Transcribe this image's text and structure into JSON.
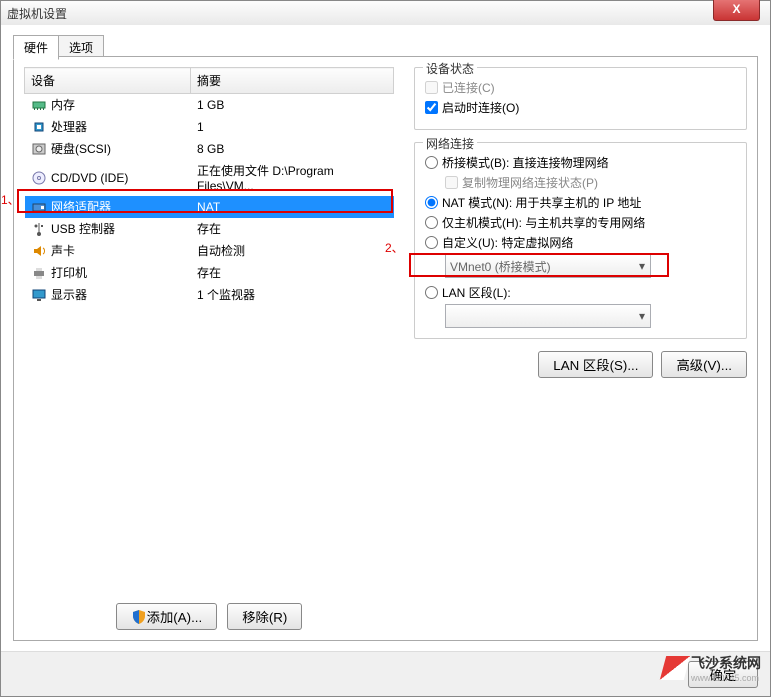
{
  "window_title": "虚拟机设置",
  "tabs": {
    "hardware": "硬件",
    "options": "选项"
  },
  "col_headers": {
    "device": "设备",
    "summary": "摘要"
  },
  "devices": [
    {
      "name": "内存",
      "summary": "1 GB",
      "icon": "memory"
    },
    {
      "name": "处理器",
      "summary": "1",
      "icon": "cpu"
    },
    {
      "name": "硬盘(SCSI)",
      "summary": "8 GB",
      "icon": "hdd"
    },
    {
      "name": "CD/DVD (IDE)",
      "summary": "正在使用文件 D:\\Program Files\\VM...",
      "icon": "cd"
    },
    {
      "name": "网络适配器",
      "summary": "NAT",
      "icon": "nic",
      "selected": true
    },
    {
      "name": "USB 控制器",
      "summary": "存在",
      "icon": "usb"
    },
    {
      "name": "声卡",
      "summary": "自动检测",
      "icon": "sound"
    },
    {
      "name": "打印机",
      "summary": "存在",
      "icon": "printer"
    },
    {
      "name": "显示器",
      "summary": "1 个监视器",
      "icon": "display"
    }
  ],
  "annotations": {
    "one": "1、",
    "two": "2、"
  },
  "left_buttons": {
    "add": "添加(A)...",
    "remove": "移除(R)"
  },
  "status_group": {
    "title": "设备状态",
    "connected": "已连接(C)",
    "connect_on": "启动时连接(O)"
  },
  "conn_group": {
    "title": "网络连接",
    "bridge": "桥接模式(B): 直接连接物理网络",
    "replicate": "复制物理网络连接状态(P)",
    "nat": "NAT 模式(N): 用于共享主机的 IP 地址",
    "hostonly": "仅主机模式(H): 与主机共享的专用网络",
    "custom": "自定义(U): 特定虚拟网络",
    "custom_select": "VMnet0 (桥接模式)",
    "lan": "LAN 区段(L):"
  },
  "right_buttons": {
    "lanseg": "LAN 区段(S)...",
    "advanced": "高级(V)..."
  },
  "footer": {
    "ok": "确定"
  },
  "brand": {
    "name": "飞沙系统网",
    "url": "www.fs0745.com"
  }
}
